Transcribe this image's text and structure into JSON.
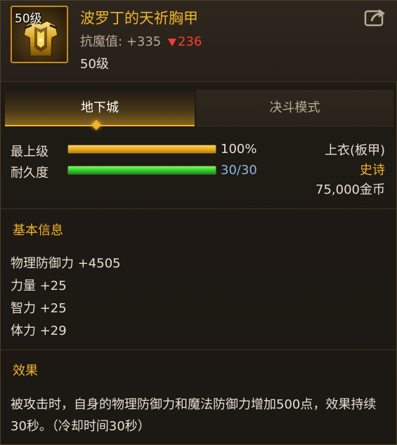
{
  "item": {
    "level_badge": "50级",
    "name": "波罗丁的天祈胸甲",
    "antimagic_label": "抗魔值:",
    "antimagic_value": "+335",
    "antimagic_diff": "236",
    "level_text": "50级",
    "icon": "golden-chest-armor-icon"
  },
  "tabs": [
    {
      "label": "地下城",
      "active": true
    },
    {
      "label": "决斗模式",
      "active": false
    }
  ],
  "bars": [
    {
      "label": "最上级",
      "value_text": "100%",
      "fraction": 1.0,
      "color": "#e8a81c"
    },
    {
      "label": "耐久度",
      "value_text": "30/30",
      "fraction": 1.0,
      "color": "#2ecb2e"
    }
  ],
  "info": {
    "slot": "上衣(板甲)",
    "rarity": "史诗",
    "price": "75,000金币"
  },
  "basic_info": {
    "title": "基本信息",
    "stats": [
      "物理防御力 +4505",
      "力量 +25",
      "智力 +25",
      "体力 +29"
    ]
  },
  "effect": {
    "title": "效果",
    "text": "被攻击时，自身的物理防御力和魔法防御力增加500点，效果持续30秒。（冷却时间30秒）"
  },
  "colors": {
    "accent": "#f0b429",
    "down": "#ff3b30"
  }
}
